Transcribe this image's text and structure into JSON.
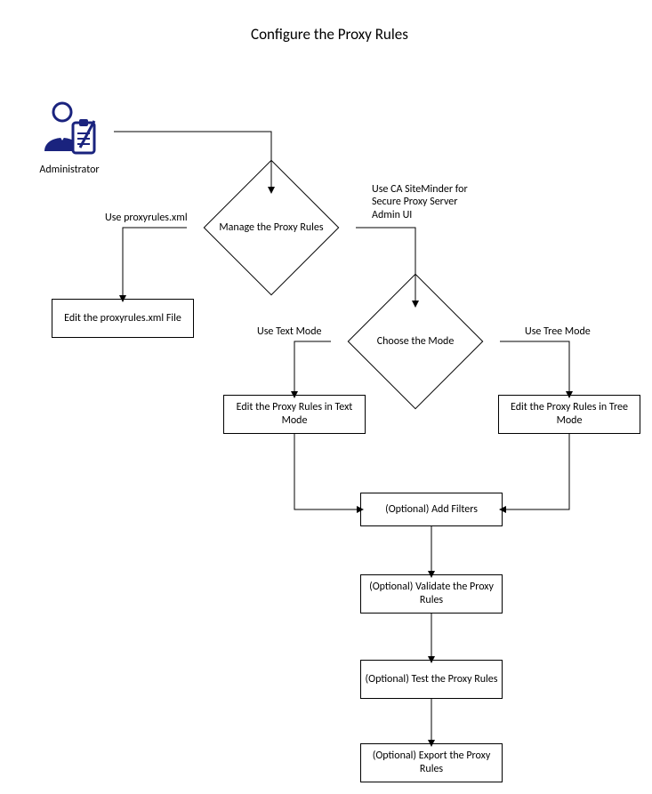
{
  "title": "Configure the Proxy Rules",
  "actor": {
    "label": "Administrator"
  },
  "nodes": {
    "d1": "Manage the Proxy Rules",
    "d2": "Choose the Mode",
    "b_edit_xml": "Edit the proxyrules.xml File",
    "b_text": "Edit the Proxy Rules in Text Mode",
    "b_tree": "Edit the Proxy Rules in Tree Mode",
    "b_filters": "(Optional) Add Filters",
    "b_validate": "(Optional) Validate the Proxy Rules",
    "b_test": "(Optional) Test the Proxy Rules",
    "b_export": "(Optional) Export the Proxy Rules"
  },
  "edges": {
    "use_xml": "Use proxyrules.xml",
    "use_adminui": "Use CA SiteMinder for Secure Proxy Server Admin UI",
    "use_text": "Use Text Mode",
    "use_tree": "Use Tree Mode"
  },
  "chart_data": {
    "type": "flowchart",
    "title": "Configure the Proxy Rules",
    "actors": [
      {
        "id": "admin",
        "label": "Administrator"
      }
    ],
    "nodes": [
      {
        "id": "d1",
        "shape": "decision",
        "label": "Manage the Proxy Rules"
      },
      {
        "id": "d2",
        "shape": "decision",
        "label": "Choose the Mode"
      },
      {
        "id": "n1",
        "shape": "process",
        "label": "Edit the proxyrules.xml File"
      },
      {
        "id": "n2",
        "shape": "process",
        "label": "Edit the Proxy Rules in Text Mode"
      },
      {
        "id": "n3",
        "shape": "process",
        "label": "Edit the Proxy Rules in Tree Mode"
      },
      {
        "id": "n4",
        "shape": "process",
        "label": "(Optional) Add Filters"
      },
      {
        "id": "n5",
        "shape": "process",
        "label": "(Optional) Validate the Proxy Rules"
      },
      {
        "id": "n6",
        "shape": "process",
        "label": "(Optional) Test the Proxy Rules"
      },
      {
        "id": "n7",
        "shape": "process",
        "label": "(Optional) Export the Proxy Rules"
      }
    ],
    "edges": [
      {
        "from": "admin",
        "to": "d1",
        "label": ""
      },
      {
        "from": "d1",
        "to": "n1",
        "label": "Use proxyrules.xml"
      },
      {
        "from": "d1",
        "to": "d2",
        "label": "Use CA SiteMinder for Secure Proxy Server Admin UI"
      },
      {
        "from": "d2",
        "to": "n2",
        "label": "Use Text Mode"
      },
      {
        "from": "d2",
        "to": "n3",
        "label": "Use Tree Mode"
      },
      {
        "from": "n2",
        "to": "n4",
        "label": ""
      },
      {
        "from": "n3",
        "to": "n4",
        "label": ""
      },
      {
        "from": "n4",
        "to": "n5",
        "label": ""
      },
      {
        "from": "n5",
        "to": "n6",
        "label": ""
      },
      {
        "from": "n6",
        "to": "n7",
        "label": ""
      }
    ]
  }
}
